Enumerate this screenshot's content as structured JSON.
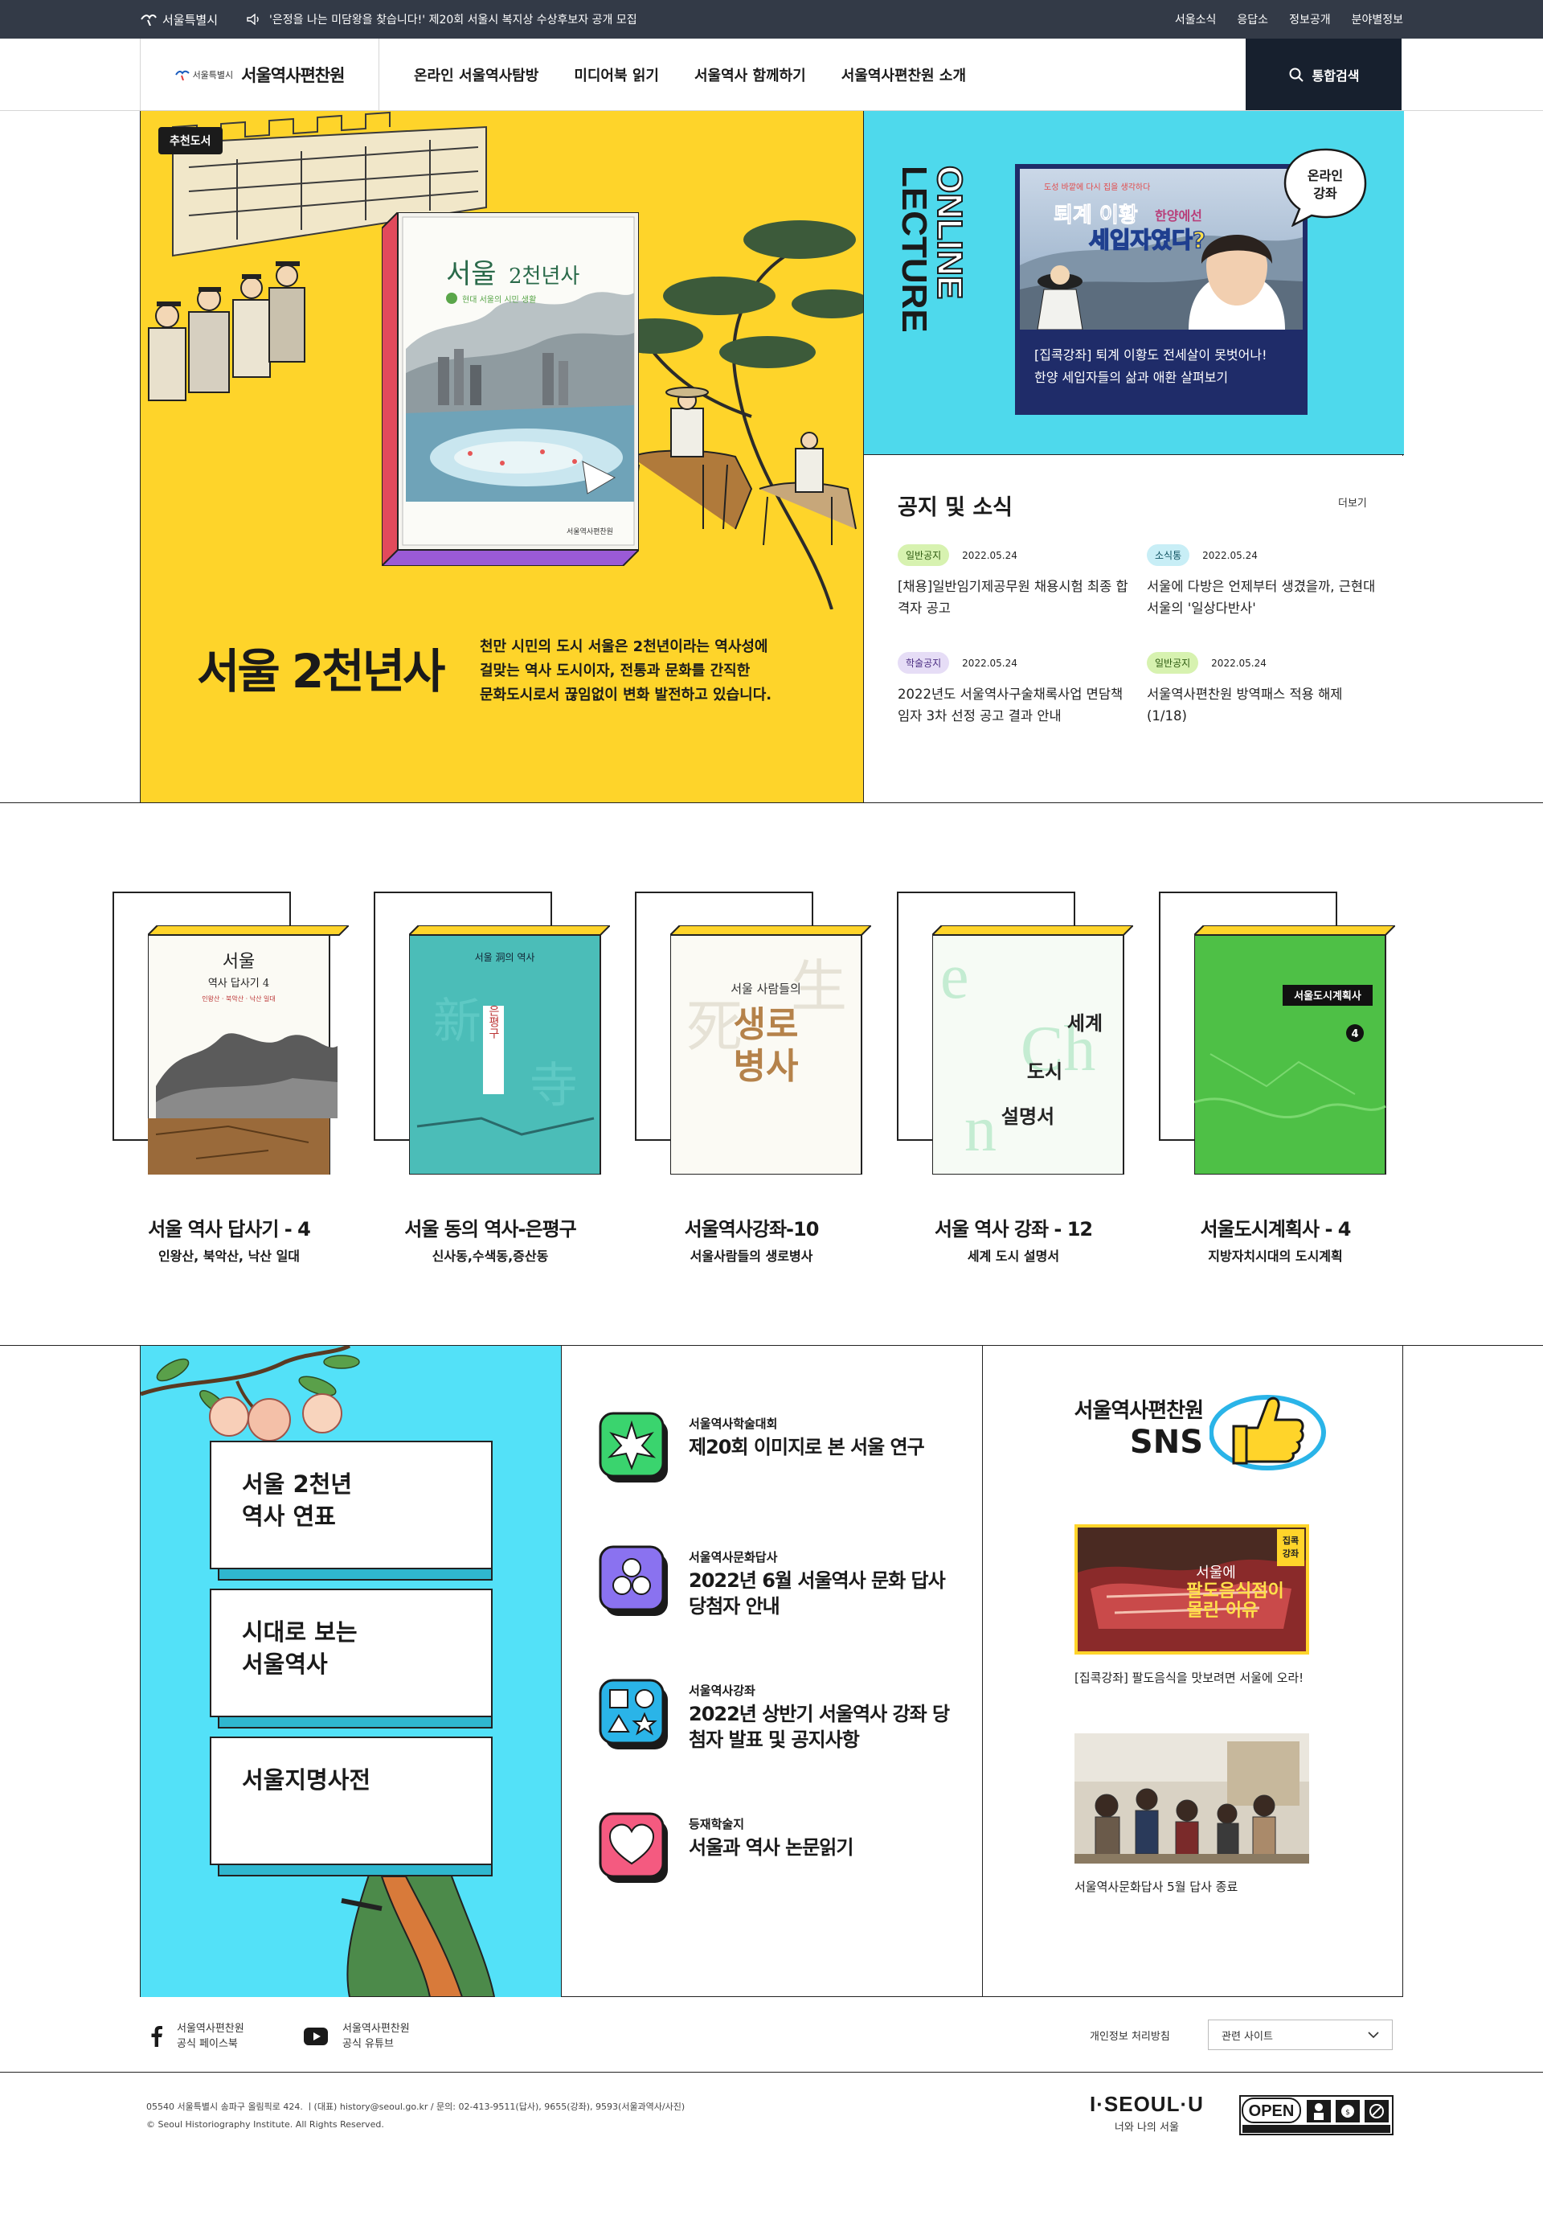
{
  "utility": {
    "seoul_gov": "서울특별시",
    "notice": "'은정을 나는 미담왕을 찾습니다!' 제20회 서울시 복지상 수상후보자 공개 모집",
    "links": [
      "서울소식",
      "응답소",
      "정보공개",
      "분야별정보"
    ]
  },
  "header": {
    "logo_small": "서울특별시",
    "logo_title": "서울역사편찬원",
    "nav": [
      "온라인 서울역사탐방",
      "미디어북 읽기",
      "서울역사 함께하기",
      "서울역사편찬원 소개"
    ],
    "search_label": "통합검색"
  },
  "hero": {
    "badge": "추천도서",
    "title": "서울 2천년사",
    "description": [
      "천만 시민의 도시 서울은 2천년이라는 역사성에",
      "걸맞는 역사 도시이자, 전통과 문화를 간직한",
      "문화도시로서 끊임없이 변화 발전하고 있습니다."
    ],
    "book_cover_title": "서울 2천년사",
    "book_cover_sub": "현대 서울의 시민 생활",
    "book_publisher": "서울역사편찬원"
  },
  "lecture": {
    "vertical_text": "ONLINE LECTURE",
    "bubble": [
      "온라인",
      "강좌"
    ],
    "thumb_small": "도성 바깥에 다시 집을 생각하다",
    "thumb_big1": "퇴계 이황",
    "thumb_big2": "한양에선",
    "thumb_big3": "세입자였다?",
    "caption": [
      "[집콕강좌] 퇴계 이황도 전세살이 못벗어나!",
      "한양 세입자들의 삶과 애환 살펴보기"
    ]
  },
  "news": {
    "title": "공지 및 소식",
    "more": "더보기",
    "items": [
      {
        "tag": "일반공지",
        "date": "2022.05.24",
        "text": "[채용]일반임기제공무원 채용시험 최종 합격자 공고",
        "color": "green"
      },
      {
        "tag": "소식통",
        "date": "2022.05.24",
        "text": "서울에 다방은 언제부터 생겼을까, 근현대 서울의 '일상다반사'",
        "color": "blue"
      },
      {
        "tag": "학술공지",
        "date": "2022.05.24",
        "text": "2022년도 서울역사구술채록사업 면담책임자 3차 선정 공고 결과 안내",
        "color": "purple"
      },
      {
        "tag": "일반공지",
        "date": "2022.05.24",
        "text": "서울역사편찬원 방역패스 적용 해제(1/18)",
        "color": "green"
      }
    ]
  },
  "shelf": [
    {
      "title": "서울 역사 답사기 - 4",
      "sub": "인왕산, 북악산, 낙산 일대",
      "cover": [
        "서울",
        "역사 답사기 4",
        "인왕산 · 북악산 · 낙산 일대"
      ],
      "cover_color": "#ffffff",
      "accent": "#e24a5c"
    },
    {
      "title": "서울 동의 역사-은평구",
      "sub": "신사동,수색동,증산동",
      "cover": [
        "서울 洞의 역사",
        "은평구"
      ],
      "cover_color": "#4bbdb8",
      "accent": "#e24a5c"
    },
    {
      "title": "서울역사강좌-10",
      "sub": "서울사람들의 생로병사",
      "cover": [
        "서울 사람들의",
        "생로",
        "병사"
      ],
      "cover_color": "#ffffff",
      "accent": "#e24a5c"
    },
    {
      "title": "서울 역사 강좌 - 12",
      "sub": "세계 도시 설명서",
      "cover": [
        "세계",
        "도시",
        "설명서"
      ],
      "cover_color": "#ffffff",
      "accent": "#e24a5c"
    },
    {
      "title": "서울도시계획사 - 4",
      "sub": "지방자치시대의 도시계획",
      "cover": [
        "서울도시계획사",
        "4"
      ],
      "cover_color": "#4ec046",
      "accent": "#e24a5c"
    }
  ],
  "menus": [
    {
      "lines": [
        "서울 2천년",
        "역사 연표"
      ]
    },
    {
      "lines": [
        "시대로 보는",
        "서울역사"
      ]
    },
    {
      "lines": [
        "서울지명사전"
      ]
    }
  ],
  "features": [
    {
      "kicker": "서울역사학술대회",
      "title": "제20회 이미지로 본 서울 연구",
      "icon": "sparkle-icon",
      "color": "#3ad46e"
    },
    {
      "kicker": "서울역사문화답사",
      "title": "2022년 6월 서울역사 문화 답사 당첨자 안내",
      "icon": "dots-icon",
      "color": "#8a72f0"
    },
    {
      "kicker": "서울역사강좌",
      "title": "2022년 상반기 서울역사 강좌 당첨자 발표 및 공지사항",
      "icon": "shapes-icon",
      "color": "#2ab4e8"
    },
    {
      "kicker": "등재학술지",
      "title": "서울과 역사 논문읽기",
      "icon": "heart-icon",
      "color": "#f45a80"
    }
  ],
  "sns": {
    "title_a": "서울역사편찬원",
    "title_b": "SNS",
    "posts": [
      {
        "caption": "[집콕강좌] 팔도음식을 맛보려면 서울에 오라!",
        "overlay1": "서울에",
        "overlay2": "팔도음식점이",
        "overlay3": "몰린 이유",
        "badge": "집콕 강좌"
      },
      {
        "caption": "서울역사문화답사 5월 답사 종료"
      }
    ]
  },
  "footer": {
    "facebook": [
      "서울역사편찬원",
      "공식 페이스북"
    ],
    "youtube": [
      "서울역사편찬원",
      "공식 유튜브"
    ],
    "privacy": "개인정보 처리방침",
    "related": "관련 사이트",
    "address": "05540 서울특별시 송파구 올림픽로 424. ㅣ(대표) history@seoul.go.kr   /   문의: 02-413-9511(답사), 9655(강좌), 9593(서울과역사/사진)",
    "copyright": "© Seoul Historiography Institute. All Rights Reserved.",
    "iseoul": "I·SEOUL·U",
    "iseoul_sub": "너와 나의 서울",
    "open": "OPEN"
  }
}
